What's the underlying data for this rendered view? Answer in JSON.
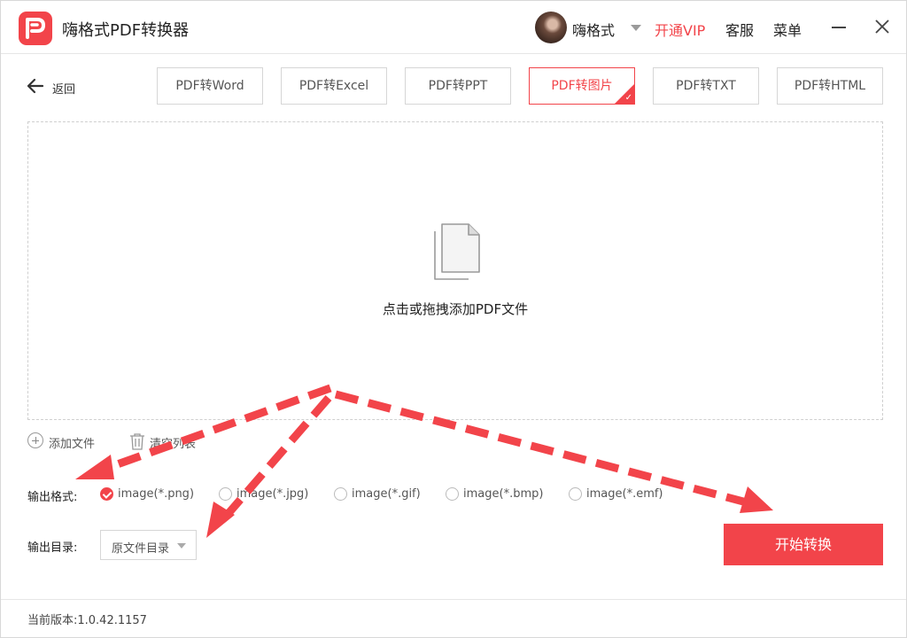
{
  "app": {
    "title": "嗨格式PDF转换器"
  },
  "header": {
    "username": "嗨格式",
    "vip_label": "开通VIP",
    "service_label": "客服",
    "menu_label": "菜单"
  },
  "nav": {
    "back_label": "返回"
  },
  "tabs": [
    {
      "label": "PDF转Word",
      "active": false
    },
    {
      "label": "PDF转Excel",
      "active": false
    },
    {
      "label": "PDF转PPT",
      "active": false
    },
    {
      "label": "PDF转图片",
      "active": true
    },
    {
      "label": "PDF转TXT",
      "active": false
    },
    {
      "label": "PDF转HTML",
      "active": false
    }
  ],
  "dropzone": {
    "label": "点击或拖拽添加PDF文件"
  },
  "file_actions": {
    "add_label": "添加文件",
    "clear_label": "清空列表"
  },
  "output_format": {
    "label": "输出格式:",
    "options": [
      {
        "label": "image(*.png)",
        "checked": true
      },
      {
        "label": "image(*.jpg)",
        "checked": false
      },
      {
        "label": "image(*.gif)",
        "checked": false
      },
      {
        "label": "image(*.bmp)",
        "checked": false
      },
      {
        "label": "image(*.emf)",
        "checked": false
      }
    ]
  },
  "output_dir": {
    "label": "输出目录:",
    "value": "原文件目录"
  },
  "start_button": {
    "label": "开始转换"
  },
  "footer": {
    "version_text": "当前版本:1.0.42.1157"
  },
  "colors": {
    "accent": "#f2444a",
    "annotation_arrow": "#f2444a"
  }
}
